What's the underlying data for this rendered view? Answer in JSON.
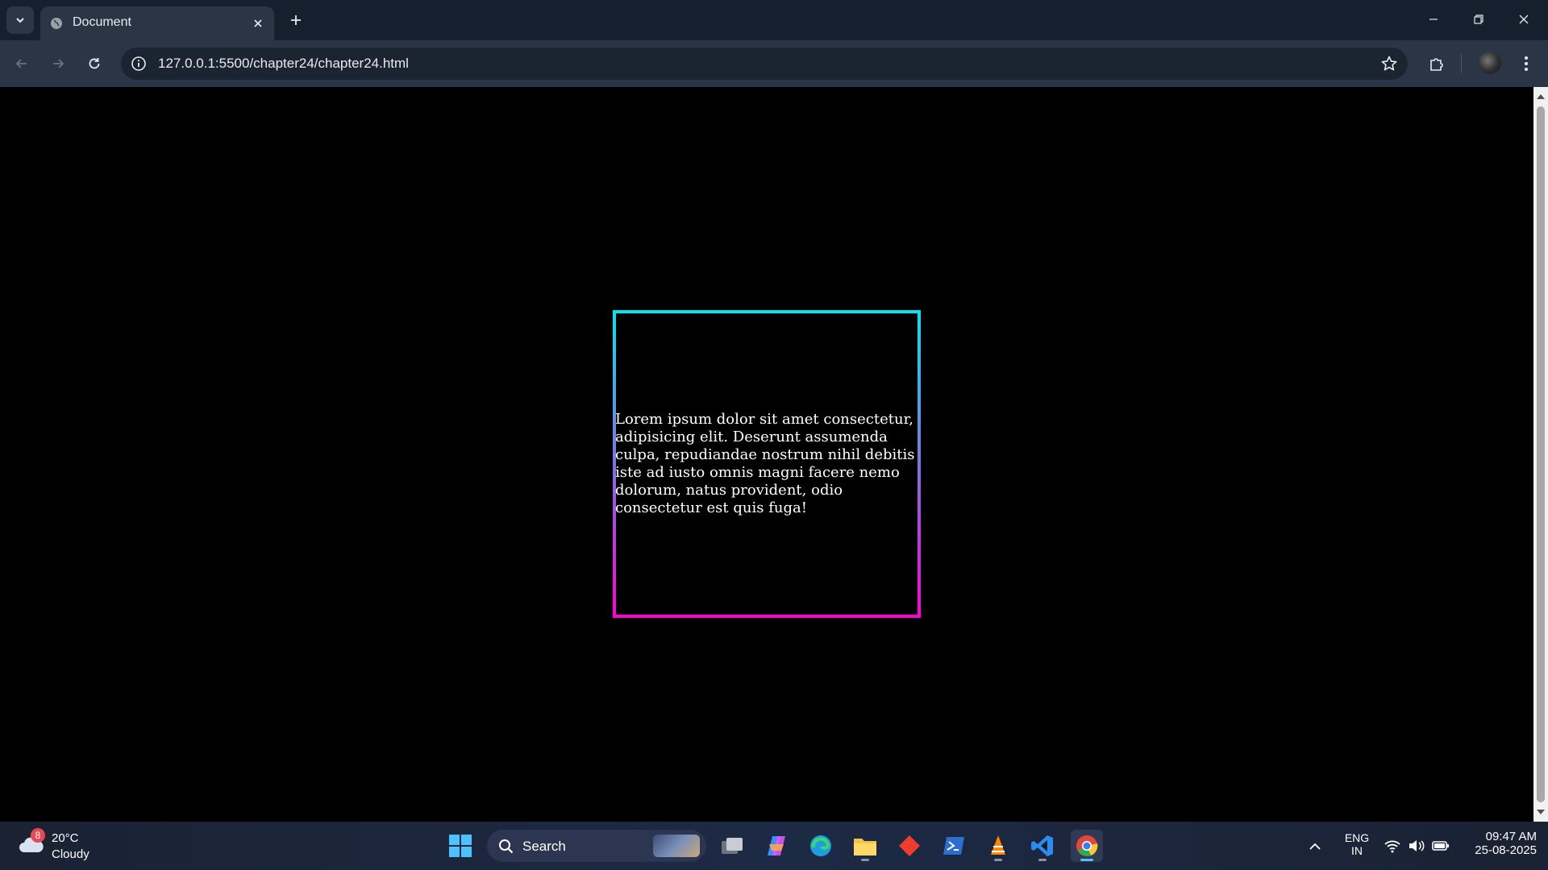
{
  "browser": {
    "tab_title": "Document",
    "url": "127.0.0.1:5500/chapter24/chapter24.html"
  },
  "page": {
    "paragraph": "Lorem ipsum dolor sit amet consectetur, adipisicing elit. Deserunt assumenda culpa, repudiandae nostrum nihil debitis iste ad iusto omnis magni facere nemo dolorum, natus provident, odio consectetur est quis fuga!",
    "gradient_colors": [
      "#00e5f2",
      "#ff00d4"
    ],
    "background": "#000000"
  },
  "taskbar": {
    "weather": {
      "temp": "20°C",
      "condition": "Cloudy",
      "badge": "8"
    },
    "search_label": "Search",
    "apps": [
      "task-view",
      "copilot",
      "edge",
      "file-explorer",
      "git",
      "powershell",
      "vlc",
      "vs-code",
      "chrome"
    ],
    "language": {
      "line1": "ENG",
      "line2": "IN"
    },
    "time": "09:47 AM",
    "date": "25-08-2025"
  }
}
